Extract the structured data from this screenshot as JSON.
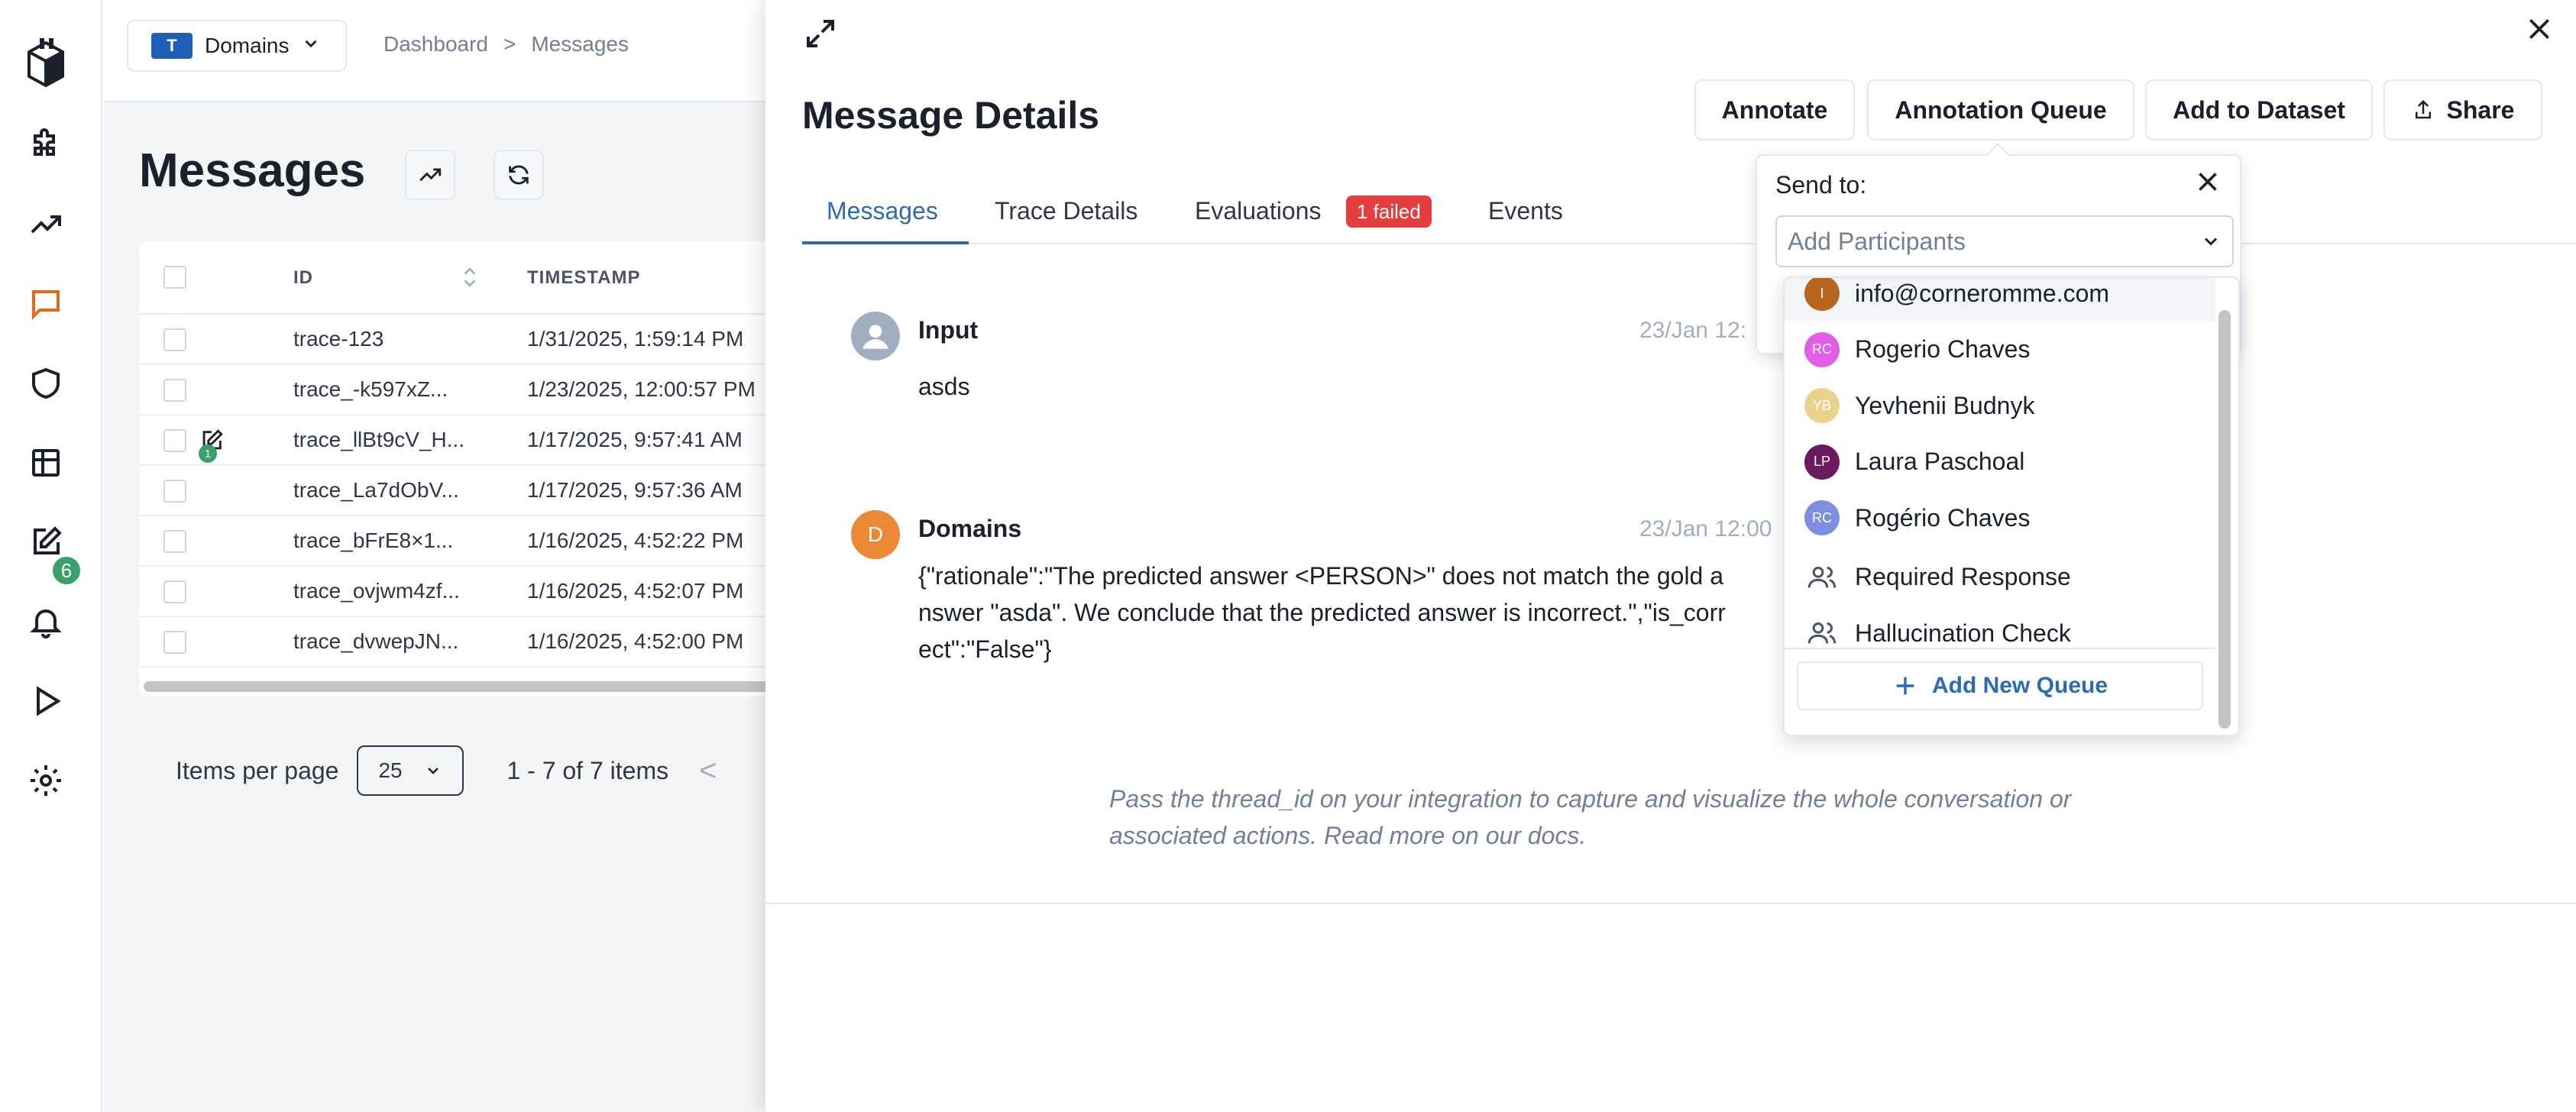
{
  "project": {
    "name": "Domains",
    "logo_text": "T"
  },
  "breadcrumb": {
    "root": "Dashboard",
    "sep": ">",
    "current": "Messages"
  },
  "page": {
    "title": "Messages"
  },
  "rail": {
    "notification_badge": "6",
    "accent": "#dd6b20"
  },
  "table": {
    "headers": {
      "id": "ID",
      "timestamp": "TIMESTAMP"
    },
    "rows": [
      {
        "id": "trace-123",
        "timestamp": "1/31/2025, 1:59:14 PM"
      },
      {
        "id": "trace_-k597xZ...",
        "timestamp": "1/23/2025, 12:00:57 PM"
      },
      {
        "id": "trace_llBt9cV_H...",
        "timestamp": "1/17/2025, 9:57:41 AM",
        "annotation_count": "1"
      },
      {
        "id": "trace_La7dObV...",
        "timestamp": "1/17/2025, 9:57:36 AM"
      },
      {
        "id": "trace_bFrE8×1...",
        "timestamp": "1/16/2025, 4:52:22 PM"
      },
      {
        "id": "trace_ovjwm4zf...",
        "timestamp": "1/16/2025, 4:52:07 PM"
      },
      {
        "id": "trace_dvwepJN...",
        "timestamp": "1/16/2025, 4:52:00 PM"
      }
    ]
  },
  "pagination": {
    "label": "Items per page",
    "per_page": "25",
    "range": "1 - 7 of 7 items",
    "prev": "<"
  },
  "drawer": {
    "title": "Message Details",
    "buttons": {
      "annotate": "Annotate",
      "annotation_queue": "Annotation Queue",
      "add_to_dataset": "Add to Dataset",
      "share": "Share"
    },
    "tabs": {
      "messages": "Messages",
      "trace_details": "Trace Details",
      "evaluations": "Evaluations",
      "evaluations_badge": "1 failed",
      "events": "Events"
    },
    "messages": [
      {
        "author": "Input",
        "time": "23/Jan 12:",
        "text": "asds",
        "avatar": ""
      },
      {
        "author": "Domains",
        "time": "23/Jan 12:00",
        "avatar": "D",
        "lines": [
          "{\"rationale\":\"The predicted answer <PERSON>\" does not match the gold a",
          "nswer \"asda\". We conclude that the predicted answer is incorrect.\",\"is_corr",
          "ect\":\"False\"}"
        ]
      }
    ],
    "note_lines": [
      "Pass the thread_id on your integration to capture and visualize the whole conversation or",
      "associated actions. Read more on our docs."
    ]
  },
  "popover": {
    "label": "Send to:",
    "placeholder": "Add Participants",
    "items": [
      {
        "initials": "I",
        "name": "info@corneromme.com",
        "color": "#b7651f"
      },
      {
        "initials": "RC",
        "name": "Rogerio Chaves",
        "color": "#e35ee6"
      },
      {
        "initials": "YB",
        "name": "Yevhenii Budnyk",
        "color": "#e8d38e"
      },
      {
        "initials": "LP",
        "name": "Laura Paschoal",
        "color": "#6b1a5e"
      },
      {
        "initials": "RC",
        "name": "Rogério Chaves",
        "color": "#7f8fdf"
      }
    ],
    "queues": [
      {
        "name": "Required Response"
      },
      {
        "name": "Hallucination Check"
      }
    ],
    "add_queue": "Add New Queue"
  }
}
